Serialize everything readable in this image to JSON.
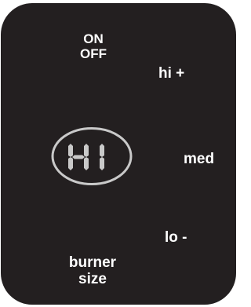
{
  "cooktop_panel": {
    "power": {
      "line1": "ON",
      "line2": "OFF"
    },
    "heat_up": {
      "label": "hi +"
    },
    "heat_mid": {
      "label": "med"
    },
    "heat_down": {
      "label": "lo -"
    },
    "burner_size": {
      "line1": "burner",
      "line2": "size"
    },
    "display": {
      "reading": "HI",
      "ring_color": "#c9c9c9",
      "segment_color": "#c9c9c9"
    },
    "colors": {
      "panel": "#231f20",
      "text": "#ffffff"
    }
  }
}
